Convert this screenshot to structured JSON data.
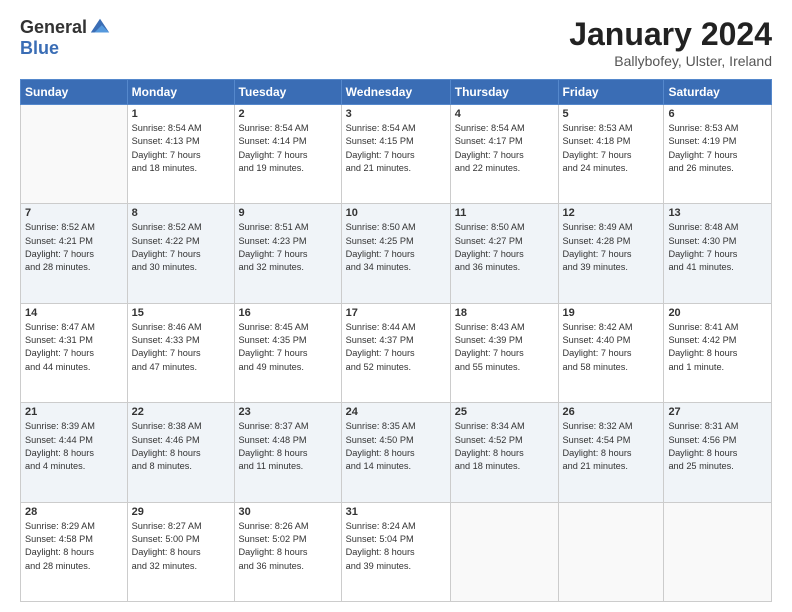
{
  "header": {
    "logo_general": "General",
    "logo_blue": "Blue",
    "month_title": "January 2024",
    "location": "Ballybofey, Ulster, Ireland"
  },
  "weekdays": [
    "Sunday",
    "Monday",
    "Tuesday",
    "Wednesday",
    "Thursday",
    "Friday",
    "Saturday"
  ],
  "weeks": [
    [
      {
        "day": "",
        "info": ""
      },
      {
        "day": "1",
        "info": "Sunrise: 8:54 AM\nSunset: 4:13 PM\nDaylight: 7 hours\nand 18 minutes."
      },
      {
        "day": "2",
        "info": "Sunrise: 8:54 AM\nSunset: 4:14 PM\nDaylight: 7 hours\nand 19 minutes."
      },
      {
        "day": "3",
        "info": "Sunrise: 8:54 AM\nSunset: 4:15 PM\nDaylight: 7 hours\nand 21 minutes."
      },
      {
        "day": "4",
        "info": "Sunrise: 8:54 AM\nSunset: 4:17 PM\nDaylight: 7 hours\nand 22 minutes."
      },
      {
        "day": "5",
        "info": "Sunrise: 8:53 AM\nSunset: 4:18 PM\nDaylight: 7 hours\nand 24 minutes."
      },
      {
        "day": "6",
        "info": "Sunrise: 8:53 AM\nSunset: 4:19 PM\nDaylight: 7 hours\nand 26 minutes."
      }
    ],
    [
      {
        "day": "7",
        "info": "Sunrise: 8:52 AM\nSunset: 4:21 PM\nDaylight: 7 hours\nand 28 minutes."
      },
      {
        "day": "8",
        "info": "Sunrise: 8:52 AM\nSunset: 4:22 PM\nDaylight: 7 hours\nand 30 minutes."
      },
      {
        "day": "9",
        "info": "Sunrise: 8:51 AM\nSunset: 4:23 PM\nDaylight: 7 hours\nand 32 minutes."
      },
      {
        "day": "10",
        "info": "Sunrise: 8:50 AM\nSunset: 4:25 PM\nDaylight: 7 hours\nand 34 minutes."
      },
      {
        "day": "11",
        "info": "Sunrise: 8:50 AM\nSunset: 4:27 PM\nDaylight: 7 hours\nand 36 minutes."
      },
      {
        "day": "12",
        "info": "Sunrise: 8:49 AM\nSunset: 4:28 PM\nDaylight: 7 hours\nand 39 minutes."
      },
      {
        "day": "13",
        "info": "Sunrise: 8:48 AM\nSunset: 4:30 PM\nDaylight: 7 hours\nand 41 minutes."
      }
    ],
    [
      {
        "day": "14",
        "info": "Sunrise: 8:47 AM\nSunset: 4:31 PM\nDaylight: 7 hours\nand 44 minutes."
      },
      {
        "day": "15",
        "info": "Sunrise: 8:46 AM\nSunset: 4:33 PM\nDaylight: 7 hours\nand 47 minutes."
      },
      {
        "day": "16",
        "info": "Sunrise: 8:45 AM\nSunset: 4:35 PM\nDaylight: 7 hours\nand 49 minutes."
      },
      {
        "day": "17",
        "info": "Sunrise: 8:44 AM\nSunset: 4:37 PM\nDaylight: 7 hours\nand 52 minutes."
      },
      {
        "day": "18",
        "info": "Sunrise: 8:43 AM\nSunset: 4:39 PM\nDaylight: 7 hours\nand 55 minutes."
      },
      {
        "day": "19",
        "info": "Sunrise: 8:42 AM\nSunset: 4:40 PM\nDaylight: 7 hours\nand 58 minutes."
      },
      {
        "day": "20",
        "info": "Sunrise: 8:41 AM\nSunset: 4:42 PM\nDaylight: 8 hours\nand 1 minute."
      }
    ],
    [
      {
        "day": "21",
        "info": "Sunrise: 8:39 AM\nSunset: 4:44 PM\nDaylight: 8 hours\nand 4 minutes."
      },
      {
        "day": "22",
        "info": "Sunrise: 8:38 AM\nSunset: 4:46 PM\nDaylight: 8 hours\nand 8 minutes."
      },
      {
        "day": "23",
        "info": "Sunrise: 8:37 AM\nSunset: 4:48 PM\nDaylight: 8 hours\nand 11 minutes."
      },
      {
        "day": "24",
        "info": "Sunrise: 8:35 AM\nSunset: 4:50 PM\nDaylight: 8 hours\nand 14 minutes."
      },
      {
        "day": "25",
        "info": "Sunrise: 8:34 AM\nSunset: 4:52 PM\nDaylight: 8 hours\nand 18 minutes."
      },
      {
        "day": "26",
        "info": "Sunrise: 8:32 AM\nSunset: 4:54 PM\nDaylight: 8 hours\nand 21 minutes."
      },
      {
        "day": "27",
        "info": "Sunrise: 8:31 AM\nSunset: 4:56 PM\nDaylight: 8 hours\nand 25 minutes."
      }
    ],
    [
      {
        "day": "28",
        "info": "Sunrise: 8:29 AM\nSunset: 4:58 PM\nDaylight: 8 hours\nand 28 minutes."
      },
      {
        "day": "29",
        "info": "Sunrise: 8:27 AM\nSunset: 5:00 PM\nDaylight: 8 hours\nand 32 minutes."
      },
      {
        "day": "30",
        "info": "Sunrise: 8:26 AM\nSunset: 5:02 PM\nDaylight: 8 hours\nand 36 minutes."
      },
      {
        "day": "31",
        "info": "Sunrise: 8:24 AM\nSunset: 5:04 PM\nDaylight: 8 hours\nand 39 minutes."
      },
      {
        "day": "",
        "info": ""
      },
      {
        "day": "",
        "info": ""
      },
      {
        "day": "",
        "info": ""
      }
    ]
  ]
}
